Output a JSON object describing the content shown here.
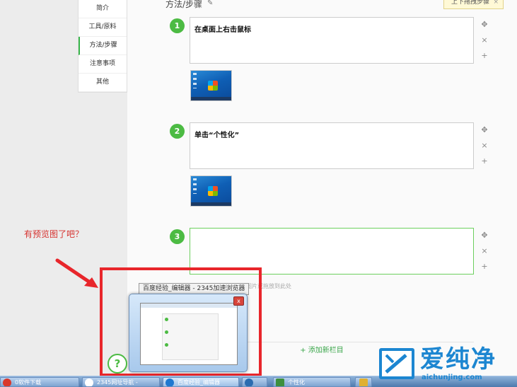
{
  "sidenav": {
    "items": [
      {
        "label": "简介"
      },
      {
        "label": "工具/原料"
      },
      {
        "label": "方法/步骤",
        "active": true
      },
      {
        "label": "注意事项"
      },
      {
        "label": "其他"
      }
    ]
  },
  "section": {
    "title": "方法/步骤"
  },
  "tooltip": {
    "text": "上下拖拽步骤",
    "close": "×"
  },
  "steps": [
    {
      "number": "1",
      "text": "在桌面上右击鼠标"
    },
    {
      "number": "2",
      "text": "单击“个性化”"
    },
    {
      "number": "3",
      "text": ""
    }
  ],
  "step_icons": {
    "move": "✥",
    "delete": "×",
    "add": "+"
  },
  "obscured_hint": "点击此处上传图片或拖放到此处",
  "add_column": {
    "icon": "+",
    "label": "添加新栏目"
  },
  "annotation": {
    "text": "有预览图了吧？"
  },
  "preview": {
    "title": "百度经验_编辑器 - 2345加速浏览器"
  },
  "help": {
    "label": "?"
  },
  "taskbar": {
    "items": [
      {
        "label": "0软件下载",
        "color": "#d9372c"
      },
      {
        "label": "2345网址导航 -",
        "color": "#ffffff"
      },
      {
        "label": "百度经验_编辑器",
        "color": "#1e78d0"
      },
      {
        "label": "",
        "color": "#2b6cb0"
      },
      {
        "label": "个性化",
        "color": "#3d8f3d"
      },
      {
        "label": "",
        "color": "#e0b030"
      }
    ]
  },
  "watermark": {
    "text": "爱纯净",
    "sub": "aichunjing.com"
  },
  "colors": {
    "accent_green": "#4cbb43",
    "highlight_red": "#e8262b",
    "brand_blue": "#1c86d1"
  }
}
